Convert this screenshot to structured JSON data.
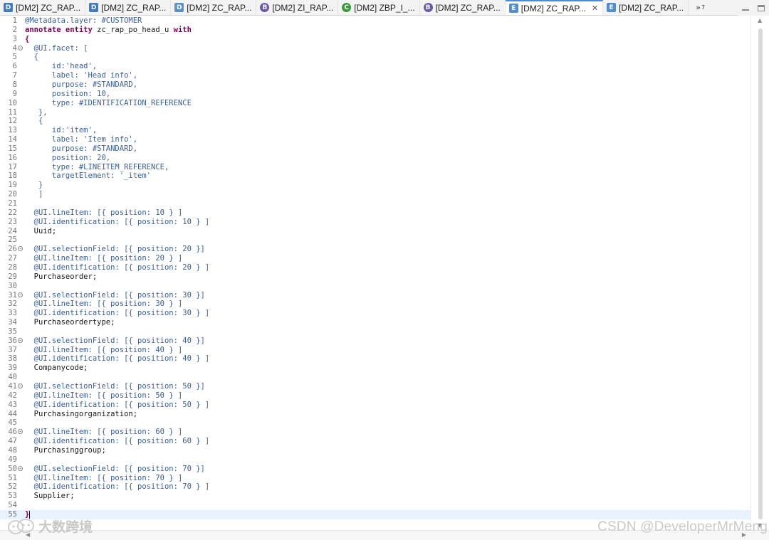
{
  "tabs": [
    {
      "label": "[DM2] ZC_RAP...",
      "icon": "ddl-source-icon",
      "glyph": "D",
      "color": "#3f7cc2",
      "shape": "square"
    },
    {
      "label": "[DM2] ZC_RAP...",
      "icon": "ddl-source-icon",
      "glyph": "D",
      "color": "#3f7cc2",
      "shape": "square"
    },
    {
      "label": "[DM2] ZC_RAP...",
      "icon": "ddl-source-icon",
      "glyph": "D",
      "color": "#5b8fc9",
      "shape": "square"
    },
    {
      "label": "[DM2] ZI_RAP...",
      "icon": "behavior-definition-icon",
      "glyph": "B",
      "color": "#6a5aa8",
      "shape": "circle"
    },
    {
      "label": "[DM2] ZBP_I_...",
      "icon": "class-icon",
      "glyph": "C",
      "color": "#3a9a3a",
      "shape": "circle"
    },
    {
      "label": "[DM2] ZC_RAP...",
      "icon": "behavior-definition-icon",
      "glyph": "B",
      "color": "#6a5aa8",
      "shape": "circle"
    },
    {
      "label": "[DM2] ZC_RAP...",
      "icon": "metadata-extension-icon",
      "glyph": "E",
      "color": "#4f8ed0",
      "shape": "square",
      "active": true
    },
    {
      "label": "[DM2] ZC_RAP...",
      "icon": "metadata-extension-icon",
      "glyph": "E",
      "color": "#4f8ed0",
      "shape": "square"
    }
  ],
  "tab_overflow": {
    "symbol": "»",
    "count": "7"
  },
  "editor": {
    "current_line": 55,
    "lines": [
      {
        "n": "1",
        "fold": false,
        "code": "@Metadata.layer: #CUSTOMER",
        "kind": "ann"
      },
      {
        "n": "2",
        "fold": false,
        "code": "",
        "kind": "header"
      },
      {
        "n": "3",
        "fold": false,
        "code": "{",
        "kind": "kw"
      },
      {
        "n": "4",
        "fold": true,
        "code": "  @UI.facet: [",
        "kind": "ann"
      },
      {
        "n": "5",
        "fold": false,
        "code": "  {",
        "kind": "ann"
      },
      {
        "n": "6",
        "fold": false,
        "code": "      id:'head',",
        "kind": "ann"
      },
      {
        "n": "7",
        "fold": false,
        "code": "      label: 'Head info',",
        "kind": "ann"
      },
      {
        "n": "8",
        "fold": false,
        "code": "      purpose: #STANDARD,",
        "kind": "ann"
      },
      {
        "n": "9",
        "fold": false,
        "code": "      position: 10,",
        "kind": "ann"
      },
      {
        "n": "10",
        "fold": false,
        "code": "      type: #IDENTIFICATION_REFERENCE",
        "kind": "ann"
      },
      {
        "n": "11",
        "fold": false,
        "code": "   },",
        "kind": "ann"
      },
      {
        "n": "12",
        "fold": false,
        "code": "   {",
        "kind": "ann"
      },
      {
        "n": "13",
        "fold": false,
        "code": "      id:'item',",
        "kind": "ann"
      },
      {
        "n": "14",
        "fold": false,
        "code": "      label: 'Item info',",
        "kind": "ann"
      },
      {
        "n": "15",
        "fold": false,
        "code": "      purpose: #STANDARD,",
        "kind": "ann"
      },
      {
        "n": "16",
        "fold": false,
        "code": "      position: 20,",
        "kind": "ann"
      },
      {
        "n": "17",
        "fold": false,
        "code": "      type: #LINEITEM_REFERENCE,",
        "kind": "ann"
      },
      {
        "n": "18",
        "fold": false,
        "code": "      targetElement: '_item'",
        "kind": "ann"
      },
      {
        "n": "19",
        "fold": false,
        "code": "   }",
        "kind": "ann"
      },
      {
        "n": "20",
        "fold": false,
        "code": "   ]",
        "kind": "ann"
      },
      {
        "n": "21",
        "fold": false,
        "code": "",
        "kind": "ann"
      },
      {
        "n": "22",
        "fold": false,
        "code": "  @UI.lineItem: [{ position: 10 } ]",
        "kind": "ann"
      },
      {
        "n": "23",
        "fold": false,
        "code": "  @UI.identification: [{ position: 10 } ]",
        "kind": "ann"
      },
      {
        "n": "24",
        "fold": false,
        "code": "  Uuid;",
        "kind": "id"
      },
      {
        "n": "25",
        "fold": false,
        "code": "",
        "kind": "ann"
      },
      {
        "n": "26",
        "fold": true,
        "code": "  @UI.selectionField: [{ position: 20 }]",
        "kind": "ann"
      },
      {
        "n": "27",
        "fold": false,
        "code": "  @UI.lineItem: [{ position: 20 } ]",
        "kind": "ann"
      },
      {
        "n": "28",
        "fold": false,
        "code": "  @UI.identification: [{ position: 20 } ]",
        "kind": "ann"
      },
      {
        "n": "29",
        "fold": false,
        "code": "  Purchaseorder;",
        "kind": "id"
      },
      {
        "n": "30",
        "fold": false,
        "code": "",
        "kind": "ann"
      },
      {
        "n": "31",
        "fold": true,
        "code": "  @UI.selectionField: [{ position: 30 }]",
        "kind": "ann"
      },
      {
        "n": "32",
        "fold": false,
        "code": "  @UI.lineItem: [{ position: 30 } ]",
        "kind": "ann"
      },
      {
        "n": "33",
        "fold": false,
        "code": "  @UI.identification: [{ position: 30 } ]",
        "kind": "ann"
      },
      {
        "n": "34",
        "fold": false,
        "code": "  Purchaseordertype;",
        "kind": "id"
      },
      {
        "n": "35",
        "fold": false,
        "code": "",
        "kind": "ann"
      },
      {
        "n": "36",
        "fold": true,
        "code": "  @UI.selectionField: [{ position: 40 }]",
        "kind": "ann"
      },
      {
        "n": "37",
        "fold": false,
        "code": "  @UI.lineItem: [{ position: 40 } ]",
        "kind": "ann"
      },
      {
        "n": "38",
        "fold": false,
        "code": "  @UI.identification: [{ position: 40 } ]",
        "kind": "ann"
      },
      {
        "n": "39",
        "fold": false,
        "code": "  Companycode;",
        "kind": "id"
      },
      {
        "n": "40",
        "fold": false,
        "code": "",
        "kind": "ann"
      },
      {
        "n": "41",
        "fold": true,
        "code": "  @UI.selectionField: [{ position: 50 }]",
        "kind": "ann"
      },
      {
        "n": "42",
        "fold": false,
        "code": "  @UI.lineItem: [{ position: 50 } ]",
        "kind": "ann"
      },
      {
        "n": "43",
        "fold": false,
        "code": "  @UI.identification: [{ position: 50 } ]",
        "kind": "ann"
      },
      {
        "n": "44",
        "fold": false,
        "code": "  Purchasingorganization;",
        "kind": "id"
      },
      {
        "n": "45",
        "fold": false,
        "code": "",
        "kind": "ann"
      },
      {
        "n": "46",
        "fold": true,
        "code": "  @UI.lineItem: [{ position: 60 } ]",
        "kind": "ann"
      },
      {
        "n": "47",
        "fold": false,
        "code": "  @UI.identification: [{ position: 60 } ]",
        "kind": "ann"
      },
      {
        "n": "48",
        "fold": false,
        "code": "  Purchasinggroup;",
        "kind": "id"
      },
      {
        "n": "49",
        "fold": false,
        "code": "",
        "kind": "ann"
      },
      {
        "n": "50",
        "fold": true,
        "code": "  @UI.selectionField: [{ position: 70 }]",
        "kind": "ann"
      },
      {
        "n": "51",
        "fold": false,
        "code": "  @UI.lineItem: [{ position: 70 } ]",
        "kind": "ann"
      },
      {
        "n": "52",
        "fold": false,
        "code": "  @UI.identification: [{ position: 70 } ]",
        "kind": "ann"
      },
      {
        "n": "53",
        "fold": false,
        "code": "  Supplier;",
        "kind": "id"
      },
      {
        "n": "54",
        "fold": false,
        "code": "",
        "kind": "ann"
      },
      {
        "n": "55",
        "fold": false,
        "code": "}",
        "kind": "kw"
      }
    ],
    "header_line": {
      "keyword1": "annotate entity",
      "name": " zc_rap_po_head_u ",
      "keyword2": "with"
    }
  },
  "watermark_left": "大数跨境",
  "watermark_right": "CSDN @DeveloperMrMeng",
  "colors": {
    "annotation": "#3a5f9a",
    "keyword": "#7f0055",
    "identifier": "#1a1a1a",
    "current_line_bg": "#e8f2fe",
    "active_tab_accent": "#4c8cd6"
  }
}
